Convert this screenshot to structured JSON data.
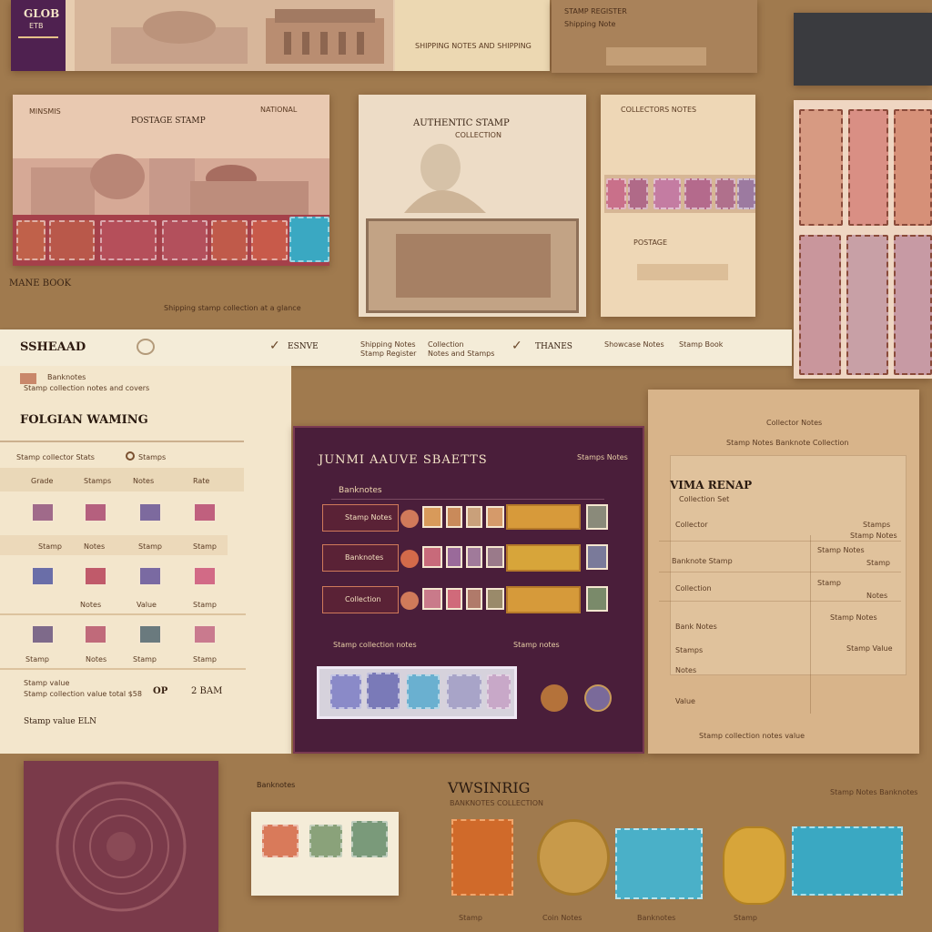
{
  "top_strip": {
    "logo_text": "GLOB",
    "logo_sub": "ETB",
    "caption_a": "SHIPPING NOTES AND SHIPPING",
    "caption_b": "STAMP REGISTER",
    "note_line": "Shipping Note"
  },
  "row1": {
    "card1": {
      "heading_left": "MINSMIS",
      "heading_mid": "POSTAGE STAMP",
      "heading_right": "NATIONAL",
      "footer": "MANE BOOK",
      "footer_small": "Shipping stamp collection at a glance"
    },
    "card2": {
      "heading": "AUTHENTIC STAMP",
      "subtitle": "COLLECTION"
    },
    "card3": {
      "heading": "COLLECTORS NOTES",
      "footer": "POSTAGE"
    }
  },
  "navbar": {
    "brand": "SSHEAAD",
    "item1": "ESNVE",
    "item2a": "Shipping Notes",
    "item2b": "Stamp Register",
    "item3a": "Collection",
    "item3b": "Notes and Stamps",
    "item4": "THANES",
    "item5a": "Showcase Notes",
    "item5b": "Stamp Book"
  },
  "left_panel": {
    "small_title": "Banknotes",
    "small_sub": "Stamp collection notes and covers",
    "title": "FOLGIAN WAMING",
    "filter_label": "Stamp collector Stats",
    "filter_value": "Stamps",
    "col_headers": [
      "Grade",
      "Stamps",
      "Notes",
      "Rate"
    ],
    "row_labels": [
      [
        "Stamp",
        "Notes",
        "Stamp",
        "Stamp"
      ],
      [
        "",
        "Notes",
        "Value",
        "Stamp"
      ],
      [
        "Stamp",
        "Notes",
        "Stamp",
        "Stamp"
      ]
    ],
    "total_label": "Stamp value",
    "total_sub": "Stamp collection value total $58",
    "total_a": "OP",
    "total_b": "2 BAM",
    "footer": "Stamp value ELN"
  },
  "main_panel": {
    "title": "JUNMI AAUVE SBAETTS",
    "title_right": "Stamps Notes",
    "section": "Banknotes",
    "rows": [
      {
        "label": "Stamp Notes"
      },
      {
        "label": "Banknotes"
      },
      {
        "label": "Collection"
      }
    ],
    "footer_left": "Stamp collection notes",
    "footer_right": "Stamp notes"
  },
  "right_panel": {
    "top_note": "Collector Notes",
    "top_sub": "Stamp Notes Banknote Collection",
    "title": "VIMA RENAP",
    "subtitle": "Collection Set",
    "rows": [
      {
        "left": "Collector",
        "right": "Stamps"
      },
      {
        "left": "",
        "right": "Stamp Notes"
      },
      {
        "left": "Banknote Stamp",
        "right": "Stamp Notes"
      },
      {
        "left": "Collection",
        "right": "Stamp"
      },
      {
        "left": "Bank Notes",
        "right": "Stamp"
      },
      {
        "left": "Stamps",
        "right": "Notes"
      },
      {
        "left": "Notes",
        "right": "Stamp Notes"
      },
      {
        "left": "Value",
        "right": "Stamp Value"
      }
    ],
    "footer": "Stamp collection notes value"
  },
  "bottom": {
    "label_mid": "Banknotes",
    "title": "VWSINRIG",
    "subtitle": "BANKNOTES COLLECTION",
    "right_label": "Stamp Notes Banknotes",
    "captions": [
      "Stamp",
      "Coin Notes",
      "Banknotes",
      "Stamp"
    ]
  },
  "colors": {
    "background": "#a07a4e",
    "main_panel": "#4a1e3a",
    "cream": "#f3e6cc",
    "accent_orange": "#d06a2a",
    "accent_teal": "#3aa8c2",
    "accent_gold": "#d7a53a"
  }
}
